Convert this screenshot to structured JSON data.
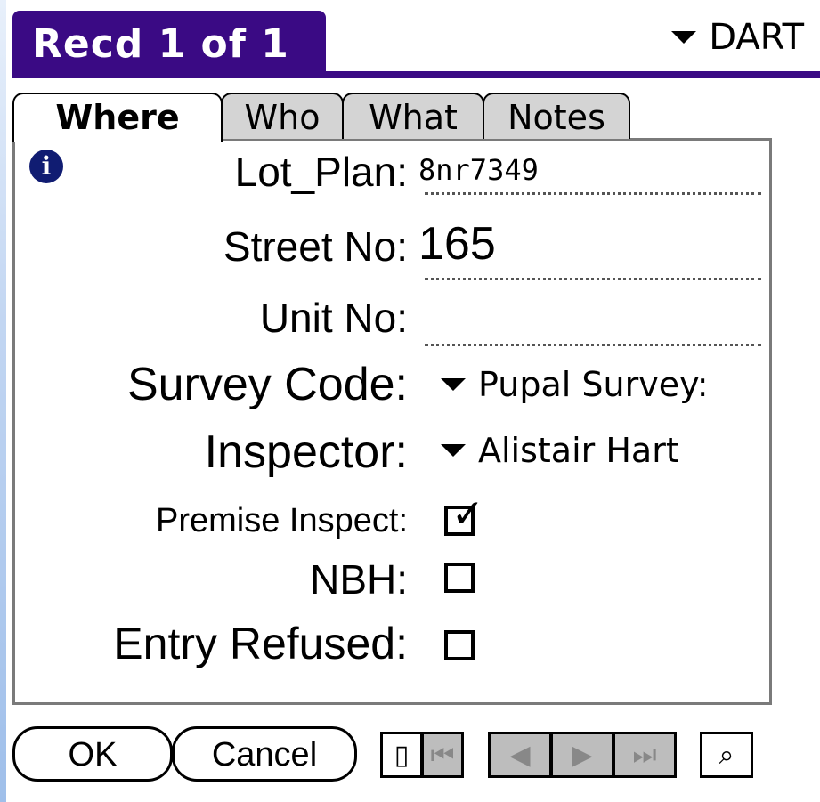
{
  "title": {
    "record_label": "Recd 1 of 1",
    "category": "DART"
  },
  "tabs": [
    {
      "label": "Where",
      "active": true
    },
    {
      "label": "Who",
      "active": false
    },
    {
      "label": "What",
      "active": false
    },
    {
      "label": "Notes",
      "active": false
    }
  ],
  "form": {
    "info_icon": "info-icon",
    "lot_plan": {
      "label": "Lot_Plan:",
      "value": "8nr7349"
    },
    "street_no": {
      "label": "Street No:",
      "value": "165"
    },
    "unit_no": {
      "label": "Unit No:",
      "value": ""
    },
    "survey_code": {
      "label": "Survey Code:",
      "value": "Pupal Survey:"
    },
    "inspector": {
      "label": "Inspector:",
      "value": "Alistair Hart"
    },
    "premise_inspect": {
      "label": "Premise Inspect:",
      "checked": true
    },
    "nbh": {
      "label": "NBH:",
      "checked": false
    },
    "entry_refused": {
      "label": "Entry Refused:",
      "checked": false
    }
  },
  "buttons": {
    "ok": "OK",
    "cancel": "Cancel"
  },
  "nav_icons": [
    "new-record-icon",
    "first-record-icon",
    "prev-record-icon",
    "next-record-icon",
    "last-record-icon",
    "find-icon"
  ],
  "colors": {
    "title_bar": "#3a0a84",
    "info_icon": "#101c72",
    "tab_inactive": "#d4d4d4"
  }
}
